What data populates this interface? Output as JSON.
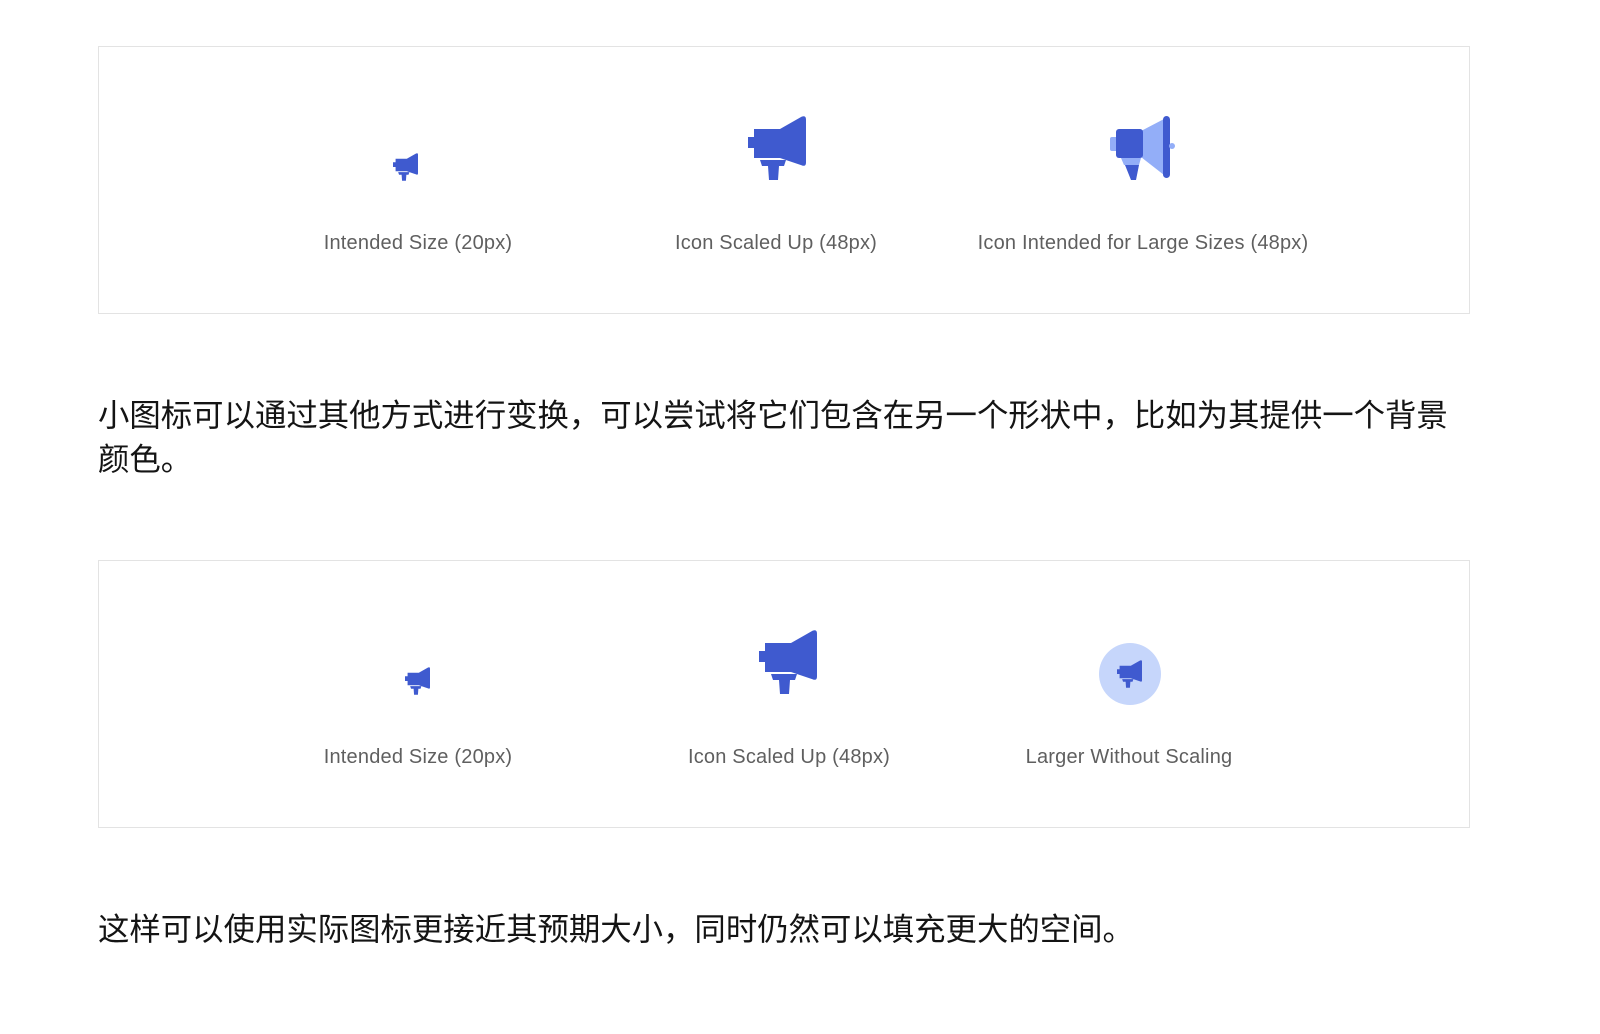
{
  "example_panels": [
    {
      "items": [
        {
          "icon": "megaphone-icon",
          "label": "Intended Size (20px)"
        },
        {
          "icon": "megaphone-icon",
          "label": "Icon Scaled Up (48px)"
        },
        {
          "icon": "megaphone-duotone-icon",
          "label": "Icon Intended for Large Sizes (48px)"
        }
      ]
    },
    {
      "items": [
        {
          "icon": "megaphone-icon",
          "label": "Intended Size (20px)"
        },
        {
          "icon": "megaphone-icon",
          "label": "Icon Scaled Up (48px)"
        },
        {
          "icon": "megaphone-icon",
          "label": "Larger Without Scaling"
        }
      ]
    }
  ],
  "paragraphs": [
    "小图标可以通过其他方式进行变换，可以尝试将它们包含在另一个形状中，比如为其提供一个背景颜色。",
    "这样可以使用实际图标更接近其预期大小，同时仍然可以填充更大的空间。"
  ],
  "colors": {
    "icon_primary": "#3F5ACF",
    "icon_secondary": "#93AEF8",
    "icon_circle_background": "#C6D6FB"
  }
}
